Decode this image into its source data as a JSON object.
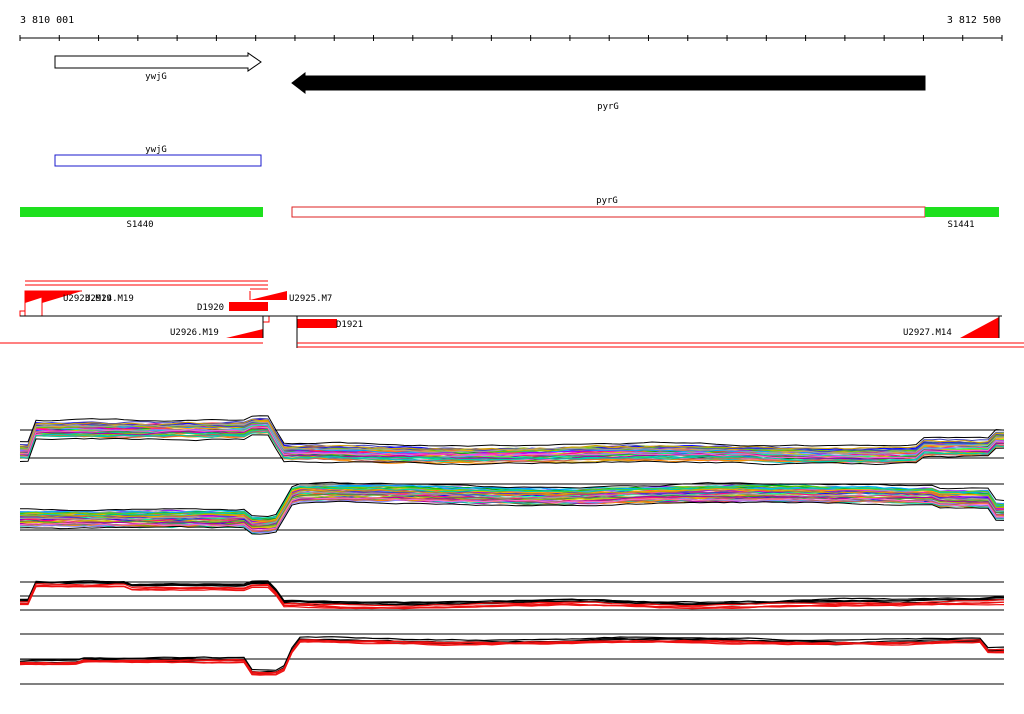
{
  "ruler": {
    "start_label": "3 810 001",
    "end_label": "3 812 500"
  },
  "genes": [
    {
      "name": "ywjG",
      "strand": "forward"
    },
    {
      "name": "pyrG",
      "strand": "reverse"
    }
  ],
  "cds": [
    {
      "name": "ywjG",
      "color": "#1a1acc"
    },
    {
      "name": "pyrG",
      "color": "#dd2222"
    }
  ],
  "segments": [
    {
      "name": "S1440",
      "color": "#1ee01e"
    },
    {
      "name": "S1441",
      "color": "#1ee01e"
    }
  ],
  "probes": [
    {
      "name": "U2923.M19"
    },
    {
      "name": "U2924.M19"
    },
    {
      "name": "D1920"
    },
    {
      "name": "U2925.M7"
    },
    {
      "name": "U2926.M19"
    },
    {
      "name": "D1921"
    },
    {
      "name": "U2927.M14"
    }
  ],
  "colors": {
    "feature": "#ff0000",
    "track_line": "#000000"
  }
}
